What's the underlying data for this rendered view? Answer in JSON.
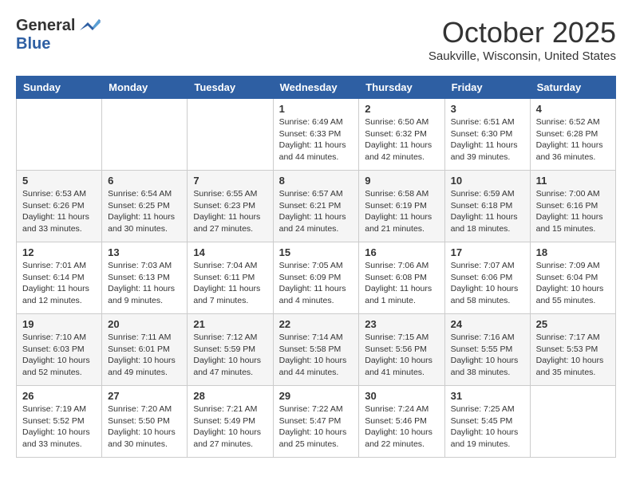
{
  "header": {
    "logo": {
      "general": "General",
      "blue": "Blue"
    },
    "title": "October 2025",
    "subtitle": "Saukville, Wisconsin, United States"
  },
  "weekdays": [
    "Sunday",
    "Monday",
    "Tuesday",
    "Wednesday",
    "Thursday",
    "Friday",
    "Saturday"
  ],
  "weeks": [
    [
      {
        "day": "",
        "info": ""
      },
      {
        "day": "",
        "info": ""
      },
      {
        "day": "",
        "info": ""
      },
      {
        "day": "1",
        "info": "Sunrise: 6:49 AM\nSunset: 6:33 PM\nDaylight: 11 hours\nand 44 minutes."
      },
      {
        "day": "2",
        "info": "Sunrise: 6:50 AM\nSunset: 6:32 PM\nDaylight: 11 hours\nand 42 minutes."
      },
      {
        "day": "3",
        "info": "Sunrise: 6:51 AM\nSunset: 6:30 PM\nDaylight: 11 hours\nand 39 minutes."
      },
      {
        "day": "4",
        "info": "Sunrise: 6:52 AM\nSunset: 6:28 PM\nDaylight: 11 hours\nand 36 minutes."
      }
    ],
    [
      {
        "day": "5",
        "info": "Sunrise: 6:53 AM\nSunset: 6:26 PM\nDaylight: 11 hours\nand 33 minutes."
      },
      {
        "day": "6",
        "info": "Sunrise: 6:54 AM\nSunset: 6:25 PM\nDaylight: 11 hours\nand 30 minutes."
      },
      {
        "day": "7",
        "info": "Sunrise: 6:55 AM\nSunset: 6:23 PM\nDaylight: 11 hours\nand 27 minutes."
      },
      {
        "day": "8",
        "info": "Sunrise: 6:57 AM\nSunset: 6:21 PM\nDaylight: 11 hours\nand 24 minutes."
      },
      {
        "day": "9",
        "info": "Sunrise: 6:58 AM\nSunset: 6:19 PM\nDaylight: 11 hours\nand 21 minutes."
      },
      {
        "day": "10",
        "info": "Sunrise: 6:59 AM\nSunset: 6:18 PM\nDaylight: 11 hours\nand 18 minutes."
      },
      {
        "day": "11",
        "info": "Sunrise: 7:00 AM\nSunset: 6:16 PM\nDaylight: 11 hours\nand 15 minutes."
      }
    ],
    [
      {
        "day": "12",
        "info": "Sunrise: 7:01 AM\nSunset: 6:14 PM\nDaylight: 11 hours\nand 12 minutes."
      },
      {
        "day": "13",
        "info": "Sunrise: 7:03 AM\nSunset: 6:13 PM\nDaylight: 11 hours\nand 9 minutes."
      },
      {
        "day": "14",
        "info": "Sunrise: 7:04 AM\nSunset: 6:11 PM\nDaylight: 11 hours\nand 7 minutes."
      },
      {
        "day": "15",
        "info": "Sunrise: 7:05 AM\nSunset: 6:09 PM\nDaylight: 11 hours\nand 4 minutes."
      },
      {
        "day": "16",
        "info": "Sunrise: 7:06 AM\nSunset: 6:08 PM\nDaylight: 11 hours\nand 1 minute."
      },
      {
        "day": "17",
        "info": "Sunrise: 7:07 AM\nSunset: 6:06 PM\nDaylight: 10 hours\nand 58 minutes."
      },
      {
        "day": "18",
        "info": "Sunrise: 7:09 AM\nSunset: 6:04 PM\nDaylight: 10 hours\nand 55 minutes."
      }
    ],
    [
      {
        "day": "19",
        "info": "Sunrise: 7:10 AM\nSunset: 6:03 PM\nDaylight: 10 hours\nand 52 minutes."
      },
      {
        "day": "20",
        "info": "Sunrise: 7:11 AM\nSunset: 6:01 PM\nDaylight: 10 hours\nand 49 minutes."
      },
      {
        "day": "21",
        "info": "Sunrise: 7:12 AM\nSunset: 5:59 PM\nDaylight: 10 hours\nand 47 minutes."
      },
      {
        "day": "22",
        "info": "Sunrise: 7:14 AM\nSunset: 5:58 PM\nDaylight: 10 hours\nand 44 minutes."
      },
      {
        "day": "23",
        "info": "Sunrise: 7:15 AM\nSunset: 5:56 PM\nDaylight: 10 hours\nand 41 minutes."
      },
      {
        "day": "24",
        "info": "Sunrise: 7:16 AM\nSunset: 5:55 PM\nDaylight: 10 hours\nand 38 minutes."
      },
      {
        "day": "25",
        "info": "Sunrise: 7:17 AM\nSunset: 5:53 PM\nDaylight: 10 hours\nand 35 minutes."
      }
    ],
    [
      {
        "day": "26",
        "info": "Sunrise: 7:19 AM\nSunset: 5:52 PM\nDaylight: 10 hours\nand 33 minutes."
      },
      {
        "day": "27",
        "info": "Sunrise: 7:20 AM\nSunset: 5:50 PM\nDaylight: 10 hours\nand 30 minutes."
      },
      {
        "day": "28",
        "info": "Sunrise: 7:21 AM\nSunset: 5:49 PM\nDaylight: 10 hours\nand 27 minutes."
      },
      {
        "day": "29",
        "info": "Sunrise: 7:22 AM\nSunset: 5:47 PM\nDaylight: 10 hours\nand 25 minutes."
      },
      {
        "day": "30",
        "info": "Sunrise: 7:24 AM\nSunset: 5:46 PM\nDaylight: 10 hours\nand 22 minutes."
      },
      {
        "day": "31",
        "info": "Sunrise: 7:25 AM\nSunset: 5:45 PM\nDaylight: 10 hours\nand 19 minutes."
      },
      {
        "day": "",
        "info": ""
      }
    ]
  ]
}
